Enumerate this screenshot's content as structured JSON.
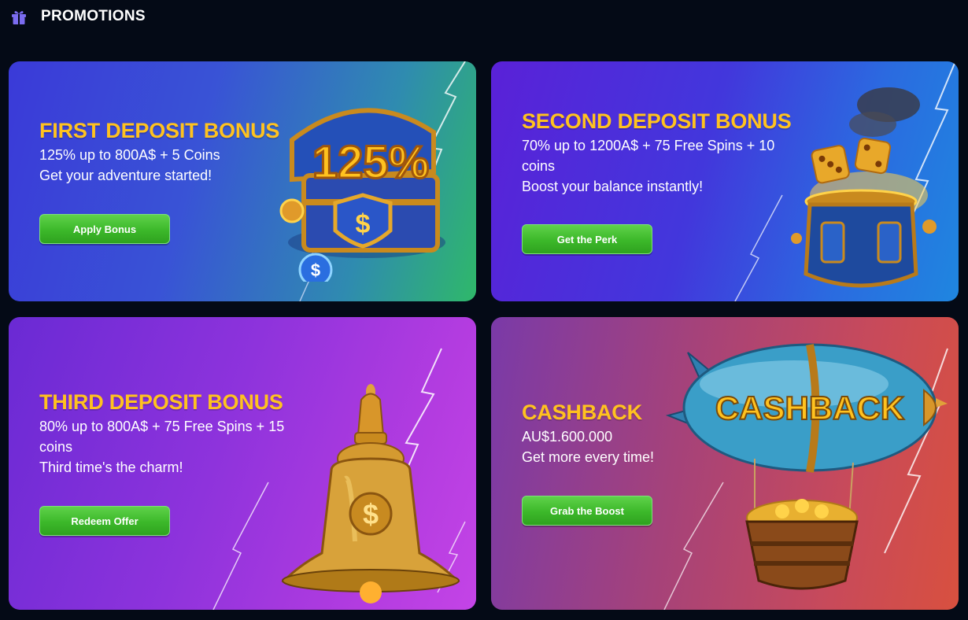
{
  "header": {
    "icon": "gift-icon",
    "title": "PROMOTIONS",
    "icon_color": "#7b6cf0"
  },
  "promotions": [
    {
      "title": "FIRST DEPOSIT BONUS",
      "lines": [
        "125% up to 800A$ + 5 Coins",
        "Get your adventure started!"
      ],
      "button": "Apply Bonus",
      "art": "treasure-chest-125-percent",
      "art_text": "125%"
    },
    {
      "title": "SECOND DEPOSIT BONUS",
      "lines": [
        "70% up to 1200A$ + 75 Free Spins + 10",
        "coins",
        "Boost your balance instantly!"
      ],
      "button": "Get the Perk",
      "art": "dice-machine"
    },
    {
      "title": "THIRD DEPOSIT BONUS",
      "lines": [
        "80% up to 800A$ + 75 Free Spins + 15",
        "coins",
        "Third time's the charm!"
      ],
      "button": "Redeem Offer",
      "art": "golden-bell"
    },
    {
      "title": "CASHBACK",
      "lines": [
        "AU$1.600.000",
        "Get more every time!"
      ],
      "button": "Grab the Boost",
      "art": "airship-with-gold",
      "art_text": "CASHBACK"
    }
  ],
  "colors": {
    "title": "#ffc21f",
    "button": "#3cb82a",
    "background": "#040a16"
  }
}
